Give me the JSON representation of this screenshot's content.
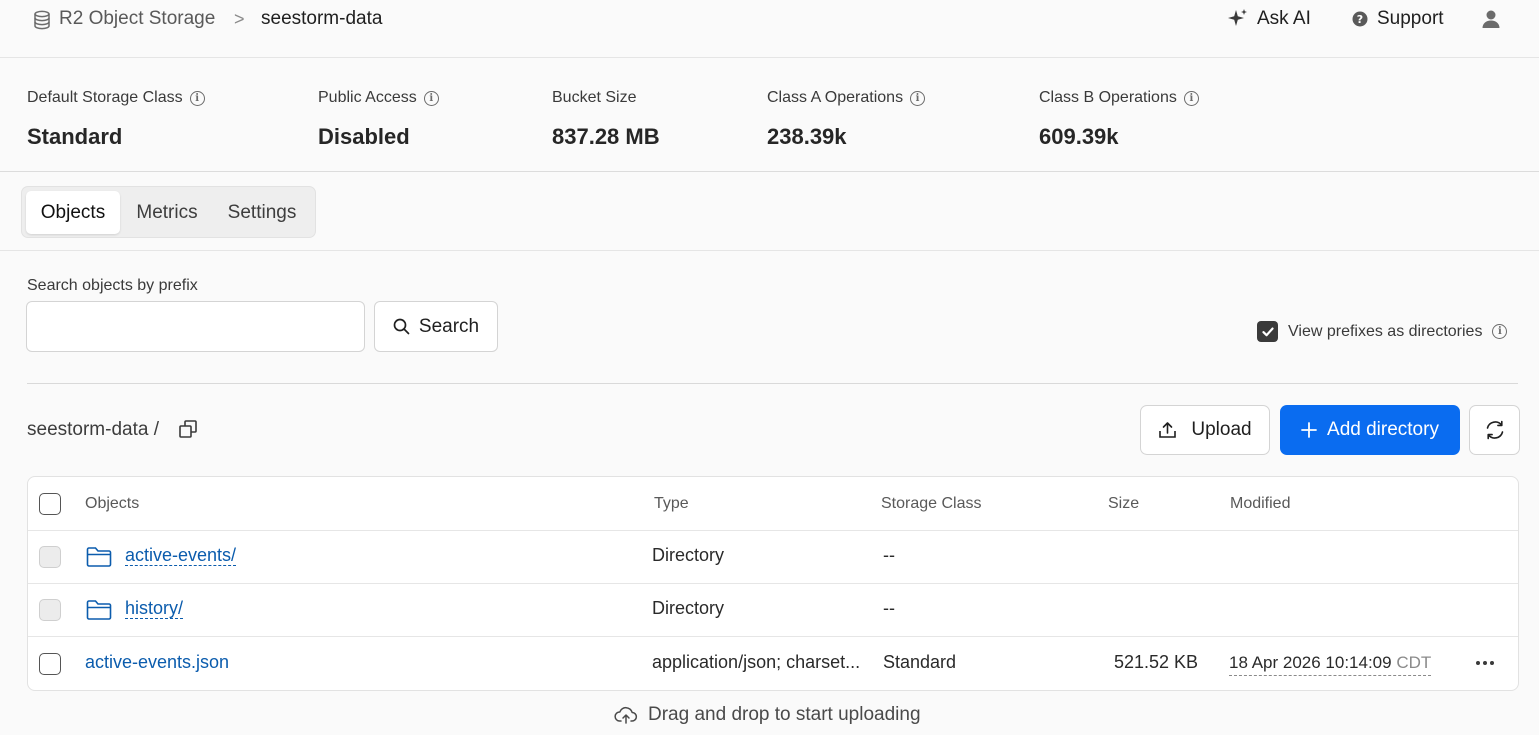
{
  "breadcrumb": {
    "root": "R2 Object Storage",
    "separator": ">",
    "current": "seestorm-data"
  },
  "header": {
    "ask_ai": "Ask AI",
    "support": "Support"
  },
  "stats": [
    {
      "label": "Default Storage Class",
      "value": "Standard"
    },
    {
      "label": "Public Access",
      "value": "Disabled"
    },
    {
      "label": "Bucket Size",
      "value": "837.28 MB"
    },
    {
      "label": "Class A Operations",
      "value": "238.39k"
    },
    {
      "label": "Class B Operations",
      "value": "609.39k"
    }
  ],
  "tabs": [
    {
      "label": "Objects",
      "active": true
    },
    {
      "label": "Metrics",
      "active": false
    },
    {
      "label": "Settings",
      "active": false
    }
  ],
  "search": {
    "label": "Search objects by prefix",
    "value": "",
    "placeholder": "",
    "button": "Search"
  },
  "prefix_toggle": {
    "label": "View prefixes as directories",
    "checked": true
  },
  "path": {
    "label": "seestorm-data /"
  },
  "actions": {
    "upload": "Upload",
    "add_directory": "Add directory"
  },
  "table": {
    "columns": [
      "Objects",
      "Type",
      "Storage Class",
      "Size",
      "Modified"
    ],
    "rows": [
      {
        "name": "active-events/",
        "type": "Directory",
        "storage": "--",
        "size": "",
        "modified": "",
        "tz": "",
        "kind": "directory"
      },
      {
        "name": "history/",
        "type": "Directory",
        "storage": "--",
        "size": "",
        "modified": "",
        "tz": "",
        "kind": "directory"
      },
      {
        "name": "active-events.json",
        "type": "application/json; charset...",
        "storage": "Standard",
        "size": "521.52 KB",
        "modified": "18 Apr 2026 10:14:09",
        "tz": "CDT",
        "kind": "file"
      }
    ]
  },
  "dropzone": {
    "label": "Drag and drop to start uploading"
  },
  "colors": {
    "accent": "#0a6cf0",
    "link": "#0b5cad",
    "background": "#fafafa"
  }
}
